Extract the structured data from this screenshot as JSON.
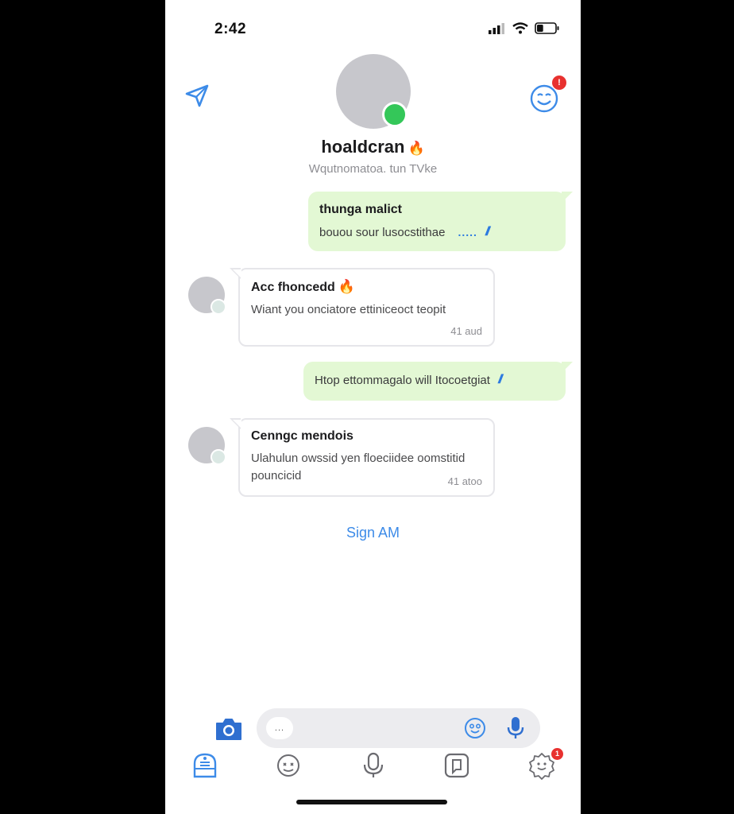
{
  "status_bar": {
    "time": "2:42",
    "battery_level": 0.35
  },
  "header": {
    "name": "hoaldcran",
    "status": "Wqutnomatoa. tun TVke",
    "emoji_badge": "!",
    "online": true
  },
  "messages": [
    {
      "direction": "out",
      "title": "thunga malict",
      "body": "bouou sour lusocstithae",
      "ticks": "//",
      "typing_dots": "....."
    },
    {
      "direction": "in",
      "title": "Acc fhoncedd",
      "body": "Wiant you onciatore ettiniceoct teopit",
      "time": "41 aud"
    },
    {
      "direction": "out",
      "body": "Htop ettommagalo will Itocoetgiat",
      "ticks": "//"
    },
    {
      "direction": "in",
      "title": "Cenngc mendois",
      "body": "Ulahulun owssid yen floeciidee oomstitid pouncicid",
      "time": "41 atoo"
    }
  ],
  "sign_link": "Sign AM",
  "composer": {
    "chip": "...",
    "placeholder": ""
  },
  "tabbar": {
    "settings_badge": "1"
  },
  "colors": {
    "accent": "#2d7be0",
    "outgoing_bubble": "#e3f8d4",
    "online": "#34c759",
    "badge": "#e8312f"
  },
  "icons": [
    "send-icon",
    "emoji-icon",
    "camera-icon",
    "smiley-icon",
    "mic-icon",
    "home-icon",
    "sticker-icon",
    "stories-icon",
    "settings-icon"
  ]
}
